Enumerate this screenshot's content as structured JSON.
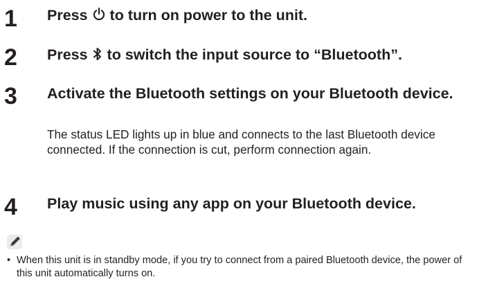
{
  "steps": [
    {
      "number": "1",
      "before": "Press ",
      "icon": "power-icon",
      "after": " to turn on power to the unit."
    },
    {
      "number": "2",
      "before": "Press ",
      "icon": "bluetooth-icon",
      "after": " to switch the input source to “Bluetooth”."
    },
    {
      "number": "3",
      "title": "Activate the Bluetooth settings on your Bluetooth device.",
      "description": "The status LED lights up in blue and connects to the last Bluetooth device connected. If the connection is cut, perform connection again."
    },
    {
      "number": "4",
      "title": "Play music using any app on your Bluetooth device."
    }
  ],
  "note": {
    "icon": "pencil-icon",
    "bullet": "•",
    "items": [
      "When this unit is in standby mode, if you try to connect from a paired Bluetooth device, the power of this unit automatically turns on."
    ]
  }
}
